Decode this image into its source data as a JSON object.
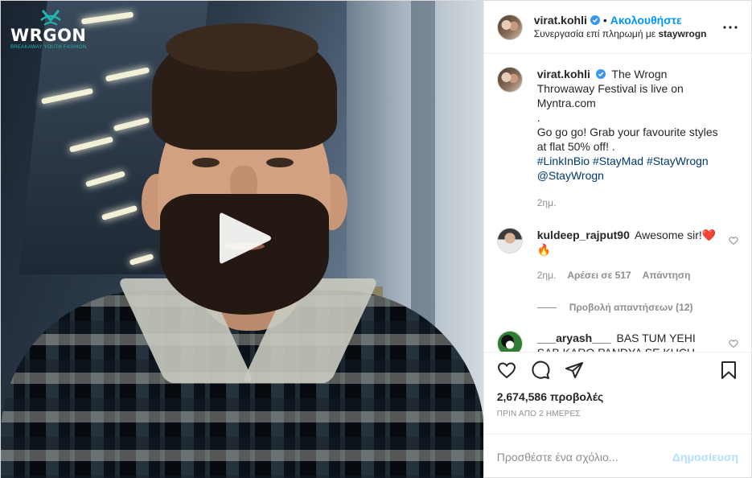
{
  "media": {
    "brand_name": "WRGON",
    "brand_tagline": "BREAKAWAY YOUTH FASHION",
    "play_icon": "play-icon"
  },
  "header": {
    "username": "virat.kohli",
    "dot": "•",
    "follow_label": "Ακολουθήστε",
    "sponsor_prefix": "Συνεργασία επί πληρωμή με",
    "sponsor_name": "staywrogn",
    "more_icon": "more-horizontal-icon"
  },
  "caption": {
    "username": "virat.kohli",
    "line1": "The Wrogn Throwaway Festival is live on Myntra.com",
    "line2": ".",
    "line3": "Go go go! Grab your favourite styles at flat 50% off! .",
    "hashtags": [
      "#LinkInBio",
      "#StayMad",
      "#StayWrogn"
    ],
    "mention": "@StayWrogn",
    "time": "2ημ."
  },
  "comments": [
    {
      "username": "kuldeep_rajput90",
      "text": "Awesome sir!❤️ 🔥",
      "time": "2ημ.",
      "likes": "Αρέσει σε 517",
      "reply": "Απάντηση",
      "view_replies": "Προβολή απαντήσεων (12)"
    },
    {
      "username": "___aryash___",
      "text": "BAS TUM YEHI SAB KARO PANDYA SE KUCH MAT SEEKHNA TUM 🤣🤣🤣🤣"
    }
  ],
  "actions": {
    "like_icon": "heart-icon",
    "comment_icon": "comment-icon",
    "share_icon": "share-icon",
    "save_icon": "bookmark-icon"
  },
  "stats": {
    "views": "2,674,586",
    "views_label": "προβολές",
    "time_ago": "ΠΡΙΝ ΑΠΟ 2 ΗΜΕΡΕΣ"
  },
  "add_comment": {
    "placeholder": "Προσθέστε ένα σχόλιο...",
    "post_label": "Δημοσίευση"
  },
  "colors": {
    "accent": "#0095f6",
    "verified": "#3897f0",
    "link": "#00376b",
    "muted": "#8e8e8e",
    "post_disabled": "#b2dffc"
  }
}
